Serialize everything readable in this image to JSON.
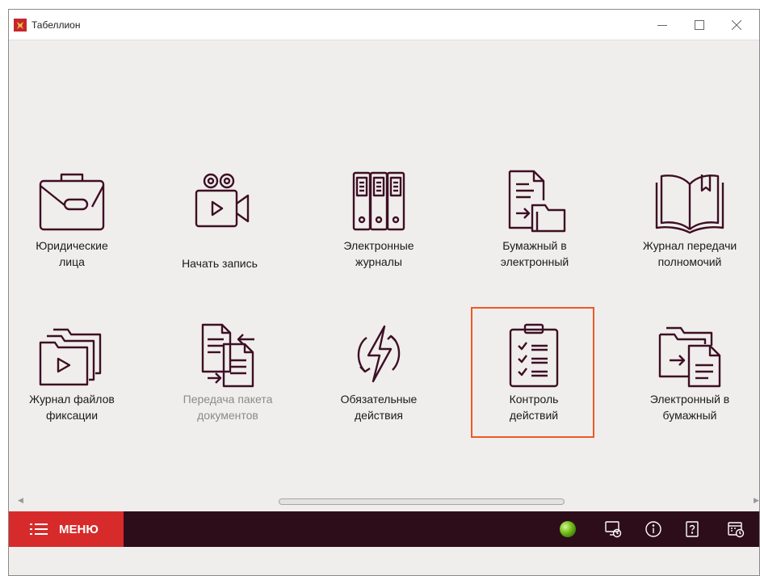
{
  "window": {
    "title": "Табеллион"
  },
  "tiles": [
    {
      "label": "Юридические\nлица",
      "icon": "briefcase-icon"
    },
    {
      "label": "Начать запись",
      "icon": "video-camera-icon"
    },
    {
      "label": "Электронные\nжурналы",
      "icon": "binders-icon"
    },
    {
      "label": "Бумажный в\nэлектронный",
      "icon": "document-to-folder-icon"
    },
    {
      "label": "Журнал передачи\nполномочий",
      "icon": "open-book-icon"
    },
    {
      "label": "Журнал файлов\nфиксации",
      "icon": "video-folder-icon"
    },
    {
      "label": "Передача пакета\nдокументов",
      "icon": "documents-transfer-icon",
      "disabled": true
    },
    {
      "label": "Обязательные\nдействия",
      "icon": "lightning-icon"
    },
    {
      "label": "Контроль\nдействий",
      "icon": "checklist-icon",
      "selected": true
    },
    {
      "label": "Электронный в\nбумажный",
      "icon": "folder-to-document-icon"
    }
  ],
  "bottombar": {
    "menu_label": "МЕНЮ"
  },
  "colors": {
    "icon": "#3d0f24",
    "accent": "#d72b2b",
    "highlight": "#ec5a24",
    "bar": "#2e0d1b",
    "status": "#6bbf1a"
  }
}
